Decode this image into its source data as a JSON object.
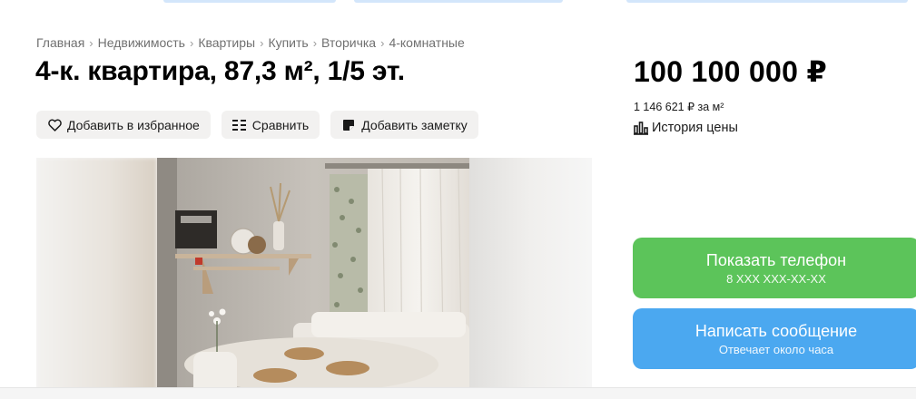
{
  "breadcrumb": [
    "Главная",
    "Недвижимость",
    "Квартиры",
    "Купить",
    "Вторичка",
    "4-комнатные"
  ],
  "breadcrumb_separator": "›",
  "listing": {
    "title": "4-к. квартира, 87,3 м², 1/5 эт.",
    "price": "100 100 000 ₽",
    "price_per_m2": "1 146 621 ₽ за м²",
    "price_history_label": "История цены"
  },
  "actions": {
    "favorite": {
      "label": "Добавить в избранное",
      "icon": "heart-icon"
    },
    "compare": {
      "label": "Сравнить",
      "icon": "compare-icon"
    },
    "note": {
      "label": "Добавить заметку",
      "icon": "note-icon"
    }
  },
  "cta": {
    "phone": {
      "label": "Показать телефон",
      "sub": "8 XXX XXX-XX-XX",
      "color": "#5cc45a"
    },
    "message": {
      "label": "Написать сообщение",
      "sub": "Отвечает около часа",
      "color": "#4ba8f0"
    }
  },
  "icons": {
    "price_history": "bar-chart-icon"
  },
  "photo": {
    "subject": "dining-room-with-shelves-and-curtains"
  }
}
